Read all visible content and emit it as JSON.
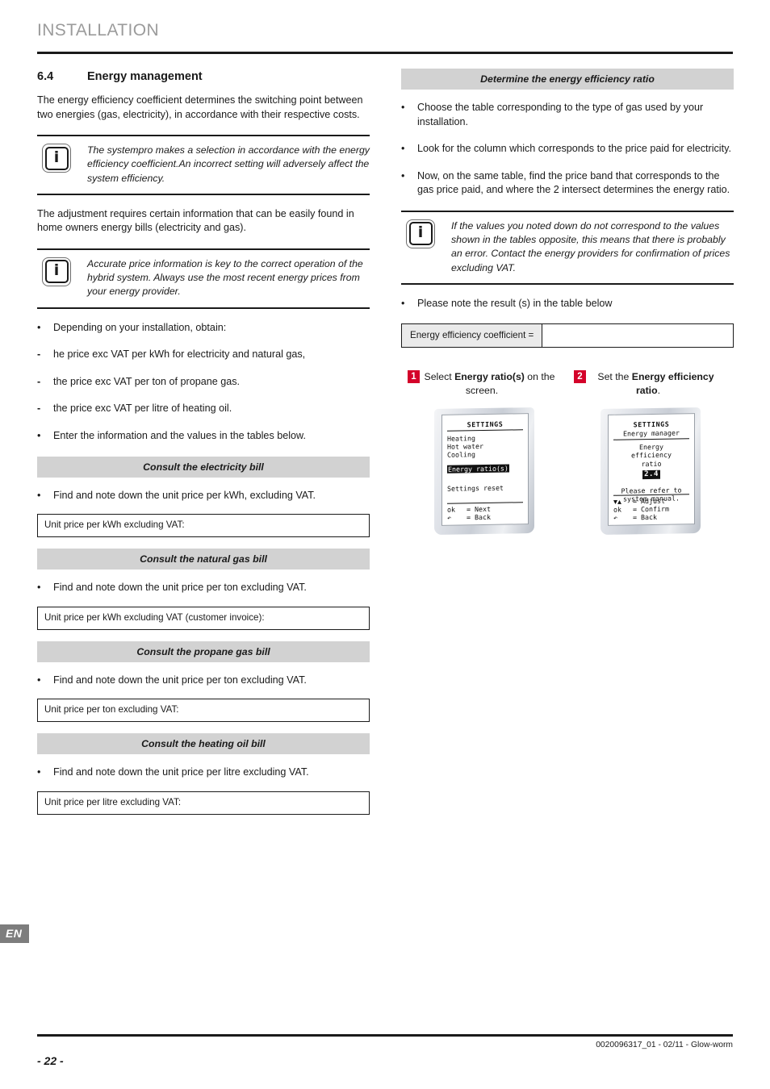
{
  "header": {
    "title": "INSTALLATION"
  },
  "section": {
    "number": "6.4",
    "title": "Energy management",
    "intro": "The energy efficiency coefficient determines the switching point between two energies (gas, electricity), in accordance with their respective costs."
  },
  "notes": {
    "note1": "The systempro makes a selection in accordance with the energy efficiency coefficient.An incorrect setting will adversely affect the system efficiency.",
    "note2": "Accurate price information is key to the correct operation of the hybrid system. Always use the most recent energy prices from your energy provider.",
    "note3": "If the values you noted down do not correspond to the values shown in the tables opposite, this means that there is probably an error. Contact the energy providers for confirmation of prices excluding VAT.",
    "icon": "info-icon",
    "glyph": "i"
  },
  "paragraphs": {
    "adjustment": "The adjustment requires certain information that can be easily found in home owners energy bills (electricity and gas)."
  },
  "obtain_list": [
    {
      "marker": "•",
      "text": "Depending on your installation, obtain:"
    },
    {
      "marker": "-",
      "text": "he price exc VAT per kWh for electricity and natural gas,"
    },
    {
      "marker": "-",
      "text": "the price exc VAT per ton of propane gas."
    },
    {
      "marker": "-",
      "text": "the price exc VAT per litre of heating oil."
    },
    {
      "marker": "•",
      "text": "Enter the information and the values in the tables below."
    }
  ],
  "bill_sections": [
    {
      "band": "Consult the electricity bill",
      "bullet_marker": "•",
      "bullet": "Find and note down the unit price per kWh, excluding VAT.",
      "entry": "Unit price per kWh excluding VAT:"
    },
    {
      "band": "Consult the natural gas bill",
      "bullet_marker": "•",
      "bullet": "Find and note down the unit price per ton excluding VAT.",
      "entry": "Unit price per kWh excluding VAT (customer invoice):"
    },
    {
      "band": "Consult the propane gas bill",
      "bullet_marker": "•",
      "bullet": "Find and note down the unit price per ton excluding VAT.",
      "entry": "Unit price per ton excluding VAT:"
    },
    {
      "band": "Consult the heating oil bill",
      "bullet_marker": "•",
      "bullet": "Find and note down the unit price per litre excluding VAT.",
      "entry": "Unit price per litre excluding VAT:"
    }
  ],
  "right": {
    "band": "Determine the energy efficiency ratio",
    "bullets": [
      {
        "marker": "•",
        "text": "Choose the table corresponding to the type of gas used by your installation."
      },
      {
        "marker": "•",
        "text": "Look for the column which corresponds to the price paid for electricity."
      },
      {
        "marker": "•",
        "text": "Now, on the same table, find the price band that corresponds to the gas price paid, and where the 2 intersect determines the energy ratio."
      }
    ],
    "result_bullet": {
      "marker": "•",
      "text": "Please note the result (s) in the table below"
    },
    "result_table": {
      "label": "Energy efficiency coefficient =",
      "value": ""
    }
  },
  "steps": [
    {
      "number": "1",
      "caption_pre": "Select ",
      "caption_bold": "Energy ratio(s)",
      "caption_post": " on the screen."
    },
    {
      "number": "2",
      "caption_pre": "Set the ",
      "caption_bold": "Energy efficiency ratio",
      "caption_post": "."
    }
  ],
  "lcd_screens": [
    {
      "title": "SETTINGS",
      "subtitle": "",
      "items": [
        "Heating",
        "Hot water",
        "Cooling"
      ],
      "selected_item": "Energy ratio(s)",
      "extra_item": "Settings reset",
      "keys": [
        {
          "key": "ok",
          "action": "= Next"
        },
        {
          "key": "↶",
          "action": "= Back"
        }
      ]
    },
    {
      "title": "SETTINGS",
      "subtitle": "Energy manager",
      "center_lines": [
        "Energy",
        "efficiency",
        "ratio"
      ],
      "value": "2.4",
      "note_lines": [
        "Please refer to",
        "system manual."
      ],
      "keys": [
        {
          "key": "▼▲",
          "action": "= Adjust"
        },
        {
          "key": "ok",
          "action": "= Confirm"
        },
        {
          "key": "↶",
          "action": "= Back"
        }
      ]
    }
  ],
  "footer": {
    "language": "EN",
    "page_number": "- 22 -",
    "reference": "0020096317_01 - 02/11 - Glow-worm"
  },
  "colors": {
    "accent_red": "#d4022a",
    "band_gray": "#d2d2d2",
    "header_gray": "#9b9b9b",
    "badge_gray": "#7d7d7d"
  }
}
